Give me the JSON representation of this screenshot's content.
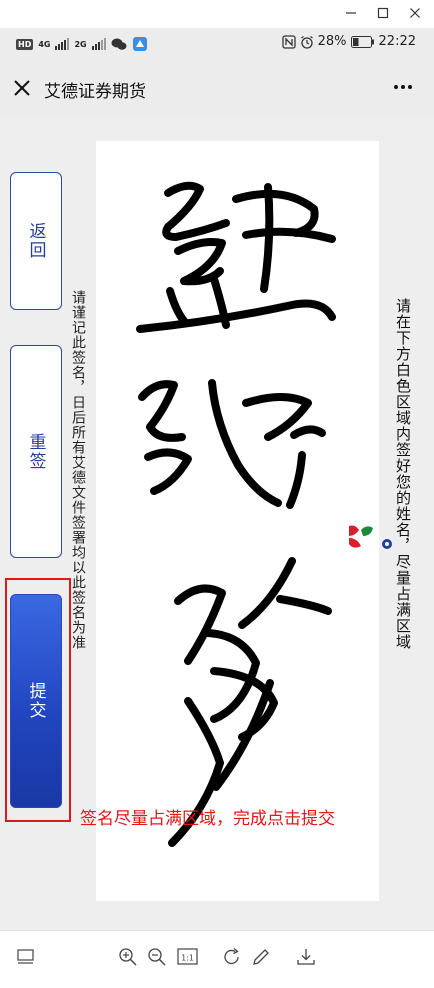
{
  "window": {
    "minimize_icon": "minimize-icon",
    "maximize_icon": "maximize-icon",
    "close_icon": "close-icon"
  },
  "status_bar": {
    "hd_tag": "HD",
    "net1_tag": "4G",
    "net2_tag": "2G",
    "battery_percent": "28%",
    "time": "22:22"
  },
  "nav": {
    "title": "艾德证券期货"
  },
  "side_buttons": {
    "back": "返回",
    "reset": "重签",
    "submit": "提交"
  },
  "instructions": {
    "left": "请谨记此签名，日后所有艾德文件签署均以此签名为准",
    "right": "请在下方白色区域内签好您的姓名，尽量占满区域",
    "red_note": "签名尽量占满区域，完成点击提交"
  },
  "colors": {
    "accent": "#243d9c",
    "submit_bg": "#2146c0",
    "annotation_red": "#e01818",
    "logo_red": "#d81e2c",
    "logo_green": "#1a8a3a",
    "logo_blue": "#1d3f9a"
  },
  "toolbar": {
    "fit_label": "1:1"
  }
}
